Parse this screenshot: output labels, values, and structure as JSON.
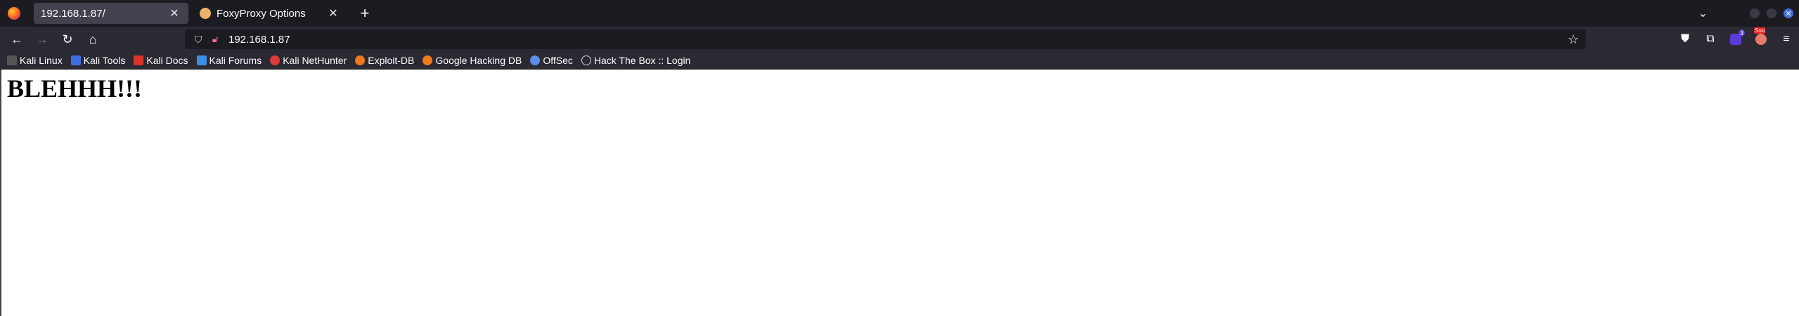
{
  "tabs": [
    {
      "title": "192.168.1.87/",
      "active": true
    },
    {
      "title": "FoxyProxy Options",
      "active": false
    }
  ],
  "toolbar": {
    "url": "192.168.1.87"
  },
  "bookmarks": [
    {
      "label": "Kali Linux",
      "icon": "kali-dragon-icon",
      "color": "#2b2a33"
    },
    {
      "label": "Kali Tools",
      "icon": "kali-tools-icon",
      "color": "#3b6ee0"
    },
    {
      "label": "Kali Docs",
      "icon": "kali-docs-icon",
      "color": "#d9332a"
    },
    {
      "label": "Kali Forums",
      "icon": "kali-forums-icon",
      "color": "#3c8de8"
    },
    {
      "label": "Kali NetHunter",
      "icon": "nethunter-icon",
      "color": "#e03a3a"
    },
    {
      "label": "Exploit-DB",
      "icon": "exploit-db-icon",
      "color": "#f07a1a"
    },
    {
      "label": "Google Hacking DB",
      "icon": "ghdb-icon",
      "color": "#f07a1a"
    },
    {
      "label": "OffSec",
      "icon": "offsec-icon",
      "color": "#5a8de8"
    },
    {
      "label": "Hack The Box :: Login",
      "icon": "globe-icon",
      "color": "#d0d0d6"
    }
  ],
  "page": {
    "heading": "BLEHHH!!!"
  }
}
